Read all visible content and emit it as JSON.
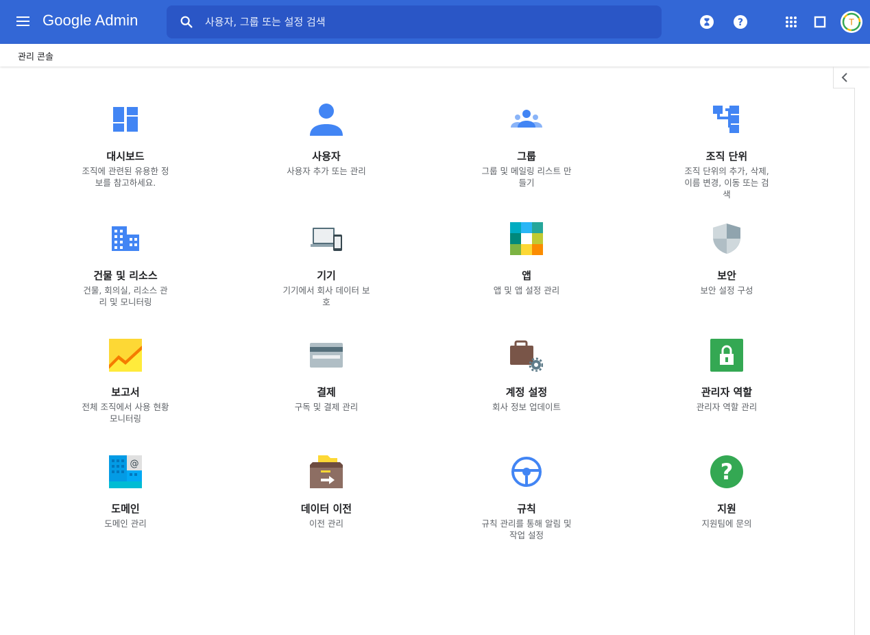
{
  "header": {
    "logo": "Google Admin",
    "search_placeholder": "사용자, 그룹 또는 설정 검색"
  },
  "breadcrumb": "관리 콘솔",
  "colors": {
    "topbar": "#3367d6",
    "search": "#2a56c6",
    "accent": "#4285f4"
  },
  "cards": [
    {
      "title": "대시보드",
      "desc": "조직에 관련된 유용한 정보를 참고하세요.",
      "icon": "dashboard-icon"
    },
    {
      "title": "사용자",
      "desc": "사용자 추가 또는 관리",
      "icon": "user-icon"
    },
    {
      "title": "그룹",
      "desc": "그룹 및 메일링 리스트 만들기",
      "icon": "groups-icon"
    },
    {
      "title": "조직 단위",
      "desc": "조직 단위의 추가, 삭제, 이름 변경, 이동 또는 검색",
      "icon": "org-units-icon"
    },
    {
      "title": "건물 및 리소스",
      "desc": "건물, 회의실, 리소스 관리 및 모니터링",
      "icon": "building-icon"
    },
    {
      "title": "기기",
      "desc": "기기에서 회사 데이터 보호",
      "icon": "devices-icon"
    },
    {
      "title": "앱",
      "desc": "앱 및 앱 설정 관리",
      "icon": "apps-icon"
    },
    {
      "title": "보안",
      "desc": "보안 설정 구성",
      "icon": "security-shield-icon"
    },
    {
      "title": "보고서",
      "desc": "전체 조직에서 사용 현황 모니터링",
      "icon": "reports-chart-icon"
    },
    {
      "title": "결제",
      "desc": "구독 및 결제 관리",
      "icon": "billing-card-icon"
    },
    {
      "title": "계정 설정",
      "desc": "회사 정보 업데이트",
      "icon": "account-settings-icon"
    },
    {
      "title": "관리자 역할",
      "desc": "관리자 역할 관리",
      "icon": "admin-roles-lock-icon"
    },
    {
      "title": "도메인",
      "desc": "도메인 관리",
      "icon": "domains-icon"
    },
    {
      "title": "데이터 이전",
      "desc": "이전 관리",
      "icon": "data-migration-icon"
    },
    {
      "title": "규칙",
      "desc": "규칙 관리를 통해 알림 및 작업 설정",
      "icon": "rules-wheel-icon"
    },
    {
      "title": "지원",
      "desc": "지원팀에 문의",
      "icon": "support-help-icon"
    }
  ]
}
